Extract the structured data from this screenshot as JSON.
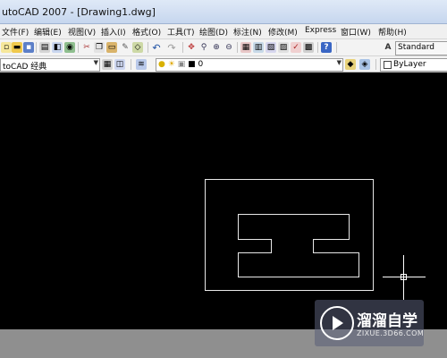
{
  "window": {
    "title": "utoCAD 2007 - [Drawing1.dwg]"
  },
  "menus": [
    "文件(F)",
    "编辑(E)",
    "视图(V)",
    "插入(I)",
    "格式(O)",
    "工具(T)",
    "绘图(D)",
    "标注(N)",
    "修改(M)",
    "Express",
    "窗口(W)",
    "帮助(H)"
  ],
  "toolbar": {
    "text_style": "Standard"
  },
  "workspace": {
    "value": "toCAD 经典"
  },
  "layer": {
    "value": "0"
  },
  "properties": {
    "color": "ByLayer"
  },
  "watermark": {
    "name": "溜溜自学",
    "url": "ZIXUE.3D66.COM"
  },
  "icons": {
    "toolbar1": [
      "new-icon",
      "open-icon",
      "save-icon",
      "print-icon",
      "plot-preview-icon",
      "publish-icon",
      "cut-icon",
      "copy-icon",
      "paste-icon",
      "match-properties-icon",
      "block-editor-icon",
      "undo-icon",
      "redo-icon",
      "pan-icon",
      "zoom-realtime-icon",
      "zoom-window-icon",
      "zoom-previous-icon",
      "properties-icon",
      "design-center-icon",
      "tool-palettes-icon",
      "sheet-set-icon",
      "markup-icon",
      "calculator-icon",
      "help-icon",
      "text-style-icon"
    ],
    "toolbar2": [
      "workspace-settings-icon",
      "layer-manager-icon",
      "layer-state-icon",
      "make-current-icon",
      "layer-previous-icon"
    ]
  }
}
